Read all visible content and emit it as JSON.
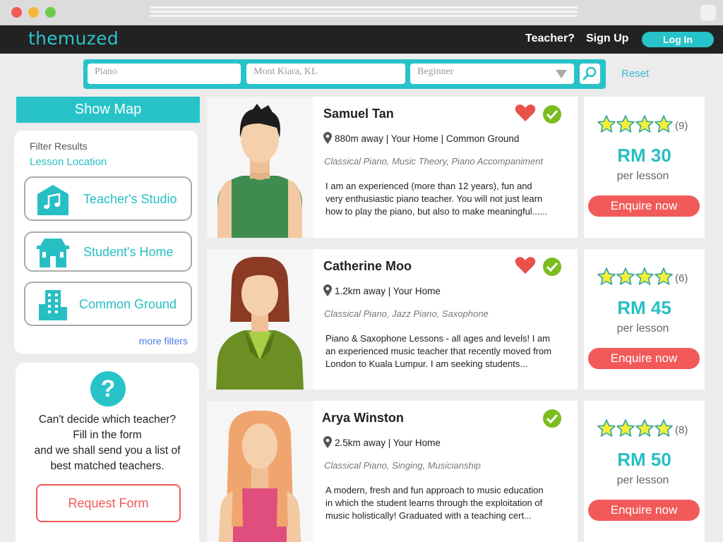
{
  "colors": {
    "accent": "#27c3c8",
    "cta": "#f25a5a",
    "heart": "#e8524a",
    "check": "#7bbd1e",
    "star": "#f5ef3a"
  },
  "header": {
    "logo": "themuzed",
    "teacher_link": "Teacher?",
    "signup_link": "Sign Up",
    "login_label": "Log In"
  },
  "search": {
    "subject_placeholder": "Piano",
    "location_placeholder": "Mont Kiara, KL",
    "level_placeholder": "Beginner",
    "search_icon": "magnifier-icon",
    "reset_label": "Reset"
  },
  "sidebar": {
    "show_map_label": "Show Map",
    "filter_title": "Filter Results",
    "filter_subtitle": "Lesson Location",
    "locations": [
      {
        "label": "Teacher's Studio",
        "icon": "music-building-icon"
      },
      {
        "label": "Student's Home",
        "icon": "house-icon"
      },
      {
        "label": "Common Ground",
        "icon": "office-building-icon"
      }
    ],
    "more_filters": "more filters",
    "help": {
      "icon": "question-icon",
      "line1": "Can't decide which teacher?",
      "line2": "Fill in the form",
      "line3": "and we shall send you a list of",
      "line4": "best matched teachers.",
      "button": "Request Form"
    }
  },
  "teachers": [
    {
      "name": "Samuel Tan",
      "location": "880m away | Your Home | Common Ground",
      "subjects": "Classical Piano, Music Theory, Piano Accompaniment",
      "desc1": "I am an experienced (more than 12 years), fun and",
      "desc2": "very enthusiastic piano teacher. You will not just learn",
      "desc3": "how to play the piano, but also to make meaningful......",
      "favorited": true,
      "verified": true,
      "rating_stars": 4,
      "reviews": "(9)",
      "price": "RM 30",
      "per": "per lesson",
      "enquire": "Enquire now"
    },
    {
      "name": "Catherine Moo",
      "location": "1.2km away | Your Home",
      "subjects": "Classical Piano, Jazz Piano, Saxophone",
      "desc1": "Piano & Saxophone Lessons - all ages and levels! I am",
      "desc2": "an experienced music teacher that recently moved from",
      "desc3": "London to Kuala Lumpur. I am seeking students...",
      "favorited": true,
      "verified": true,
      "rating_stars": 4,
      "reviews": "(6)",
      "price": "RM 45",
      "per": "per lesson",
      "enquire": "Enquire now"
    },
    {
      "name": "Arya Winston",
      "location": "2.5km away | Your Home",
      "subjects": "Classical Piano, Singing, Musicianship",
      "desc1": "A modern, fresh and fun approach to music education",
      "desc2": "in which the student learns through the exploitation of",
      "desc3": "music holistically! Graduated with a teaching cert...",
      "favorited": false,
      "verified": true,
      "rating_stars": 4,
      "reviews": "(8)",
      "price": "RM 50",
      "per": "per lesson",
      "enquire": "Enquire now"
    }
  ]
}
